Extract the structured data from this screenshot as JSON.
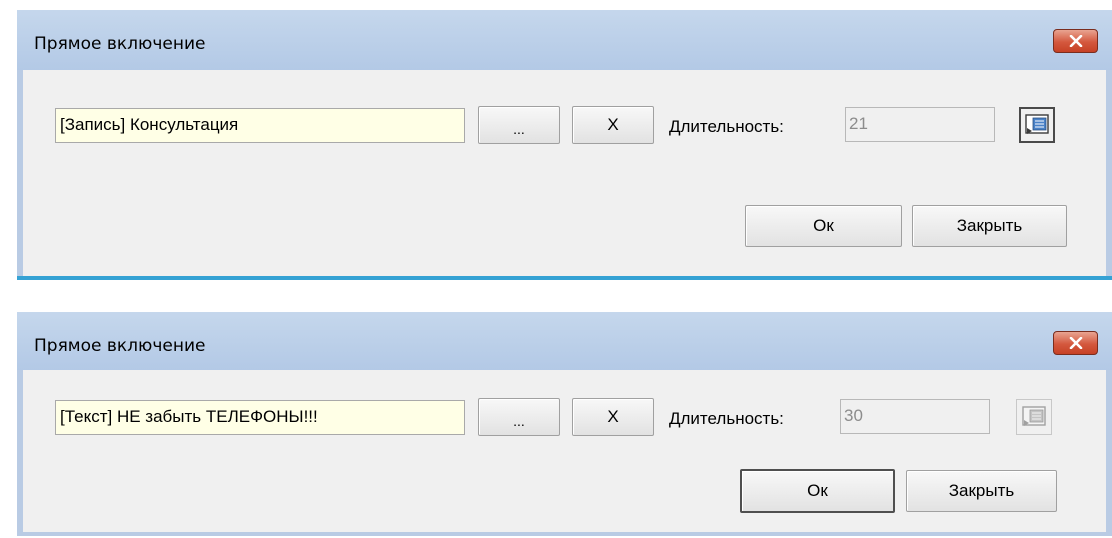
{
  "dialogs": [
    {
      "title": "Прямое включение",
      "source_field": "[Запись] Консультация",
      "browse_label": "...",
      "clear_label": "X",
      "duration_label": "Длительность:",
      "duration_value": "21",
      "ok_label": "Ок",
      "close_label": "Закрыть"
    },
    {
      "title": "Прямое включение",
      "source_field": "[Текст] НЕ забыть ТЕЛЕФОНЫ!!!",
      "browse_label": "...",
      "clear_label": "X",
      "duration_label": "Длительность:",
      "duration_value": "30",
      "ok_label": "Ок",
      "close_label": "Закрыть"
    }
  ],
  "colors": {
    "titlebar": "#b9cbe4",
    "close_button": "#c64125",
    "input_background": "#ffffe6",
    "accent_line": "#35a2d4"
  },
  "icons": {
    "close": "close-x-icon",
    "side_panel_toggle": "panel-toggle-icon"
  }
}
